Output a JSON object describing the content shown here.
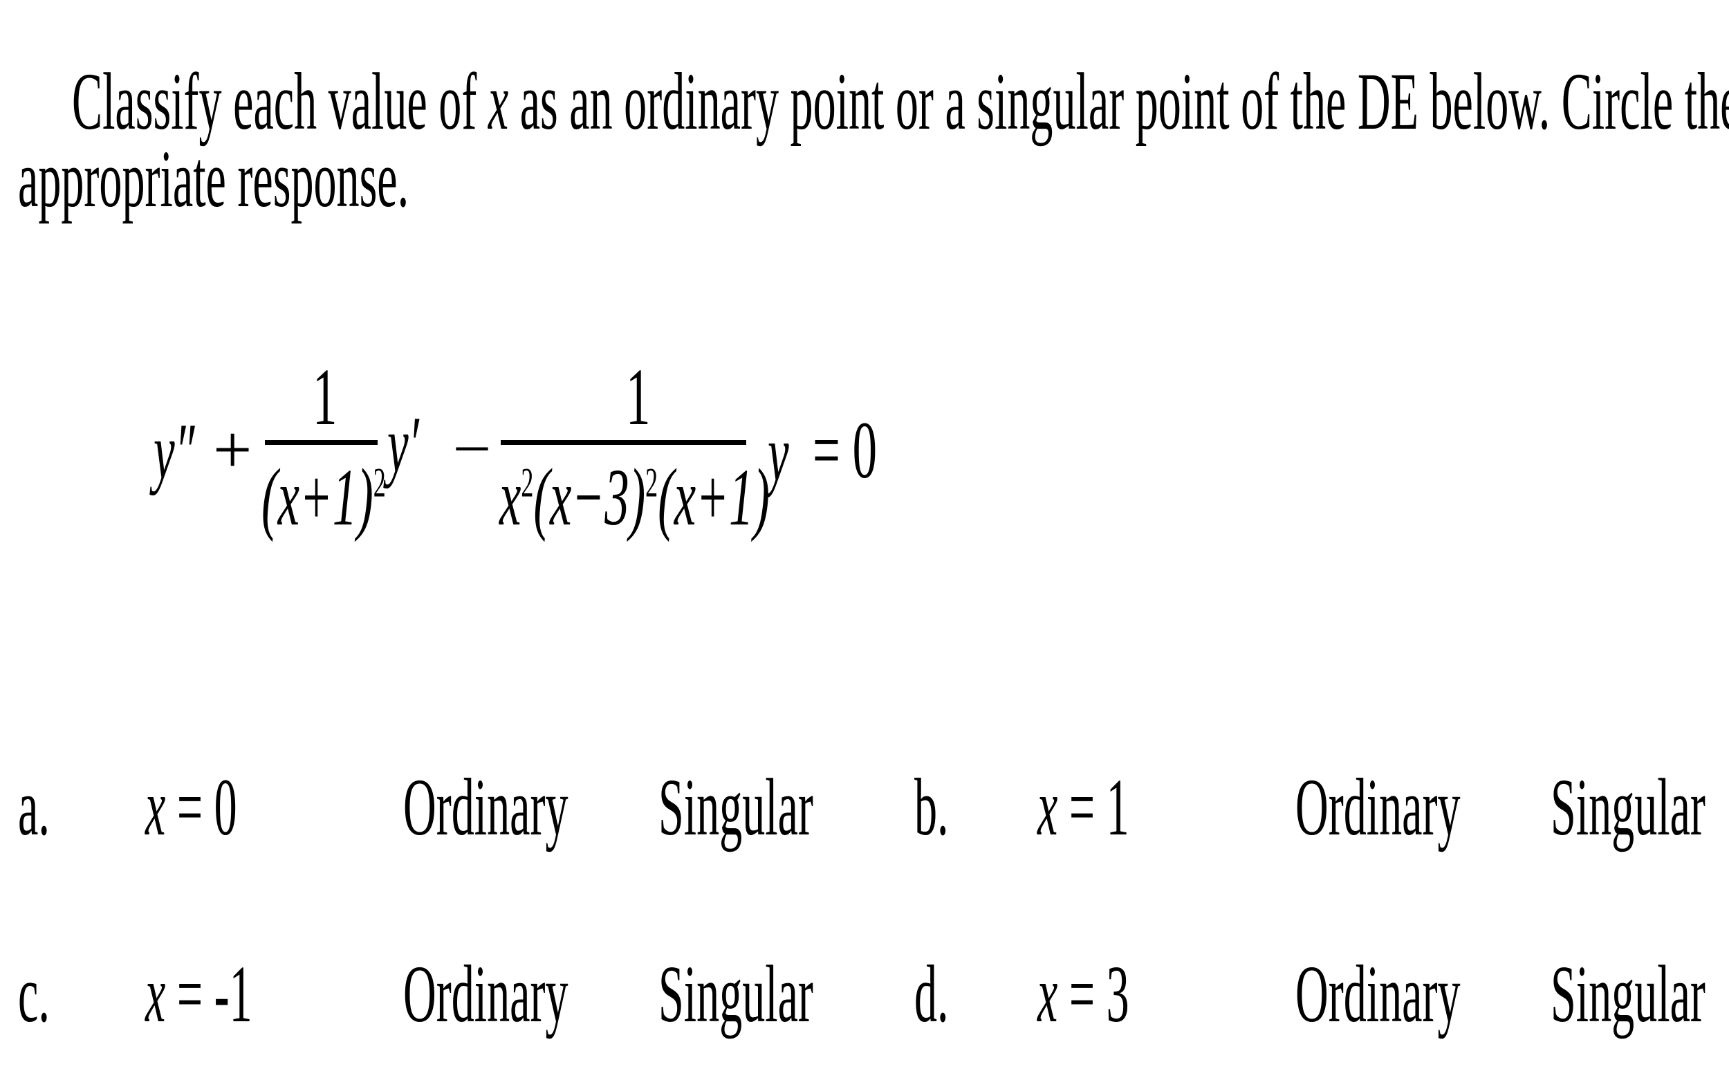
{
  "question": {
    "line1_prefix": "Classify each value of ",
    "line1_var": "x",
    "line1_suffix": " as an ordinary point or a singular point of the DE below.  Circle  the",
    "line2": "appropriate response."
  },
  "equation": {
    "term1": "y″",
    "plus": "+",
    "frac1_num": "1",
    "frac1_den": "(x+1)",
    "frac1_den_exp": "2",
    "yprime": "y′",
    "minus": "–",
    "frac2_num": "1",
    "frac2_den_a": "x",
    "frac2_den_a_exp": "2",
    "frac2_den_b": "(x−3)",
    "frac2_den_b_exp": "2",
    "frac2_den_c": "(x+1)",
    "y": "y",
    "equals": "= 0"
  },
  "items": [
    {
      "label": "a.",
      "var": "x",
      "value": " = 0",
      "option1": "Ordinary",
      "option2": "Singular"
    },
    {
      "label": "b.",
      "var": "x",
      "value": " = 1",
      "option1": "Ordinary",
      "option2": "Singular"
    },
    {
      "label": "c.",
      "var": "x",
      "value": " = -1",
      "option1": "Ordinary",
      "option2": "Singular"
    },
    {
      "label": "d.",
      "var": "x",
      "value": " = 3",
      "option1": "Ordinary",
      "option2": "Singular"
    }
  ]
}
